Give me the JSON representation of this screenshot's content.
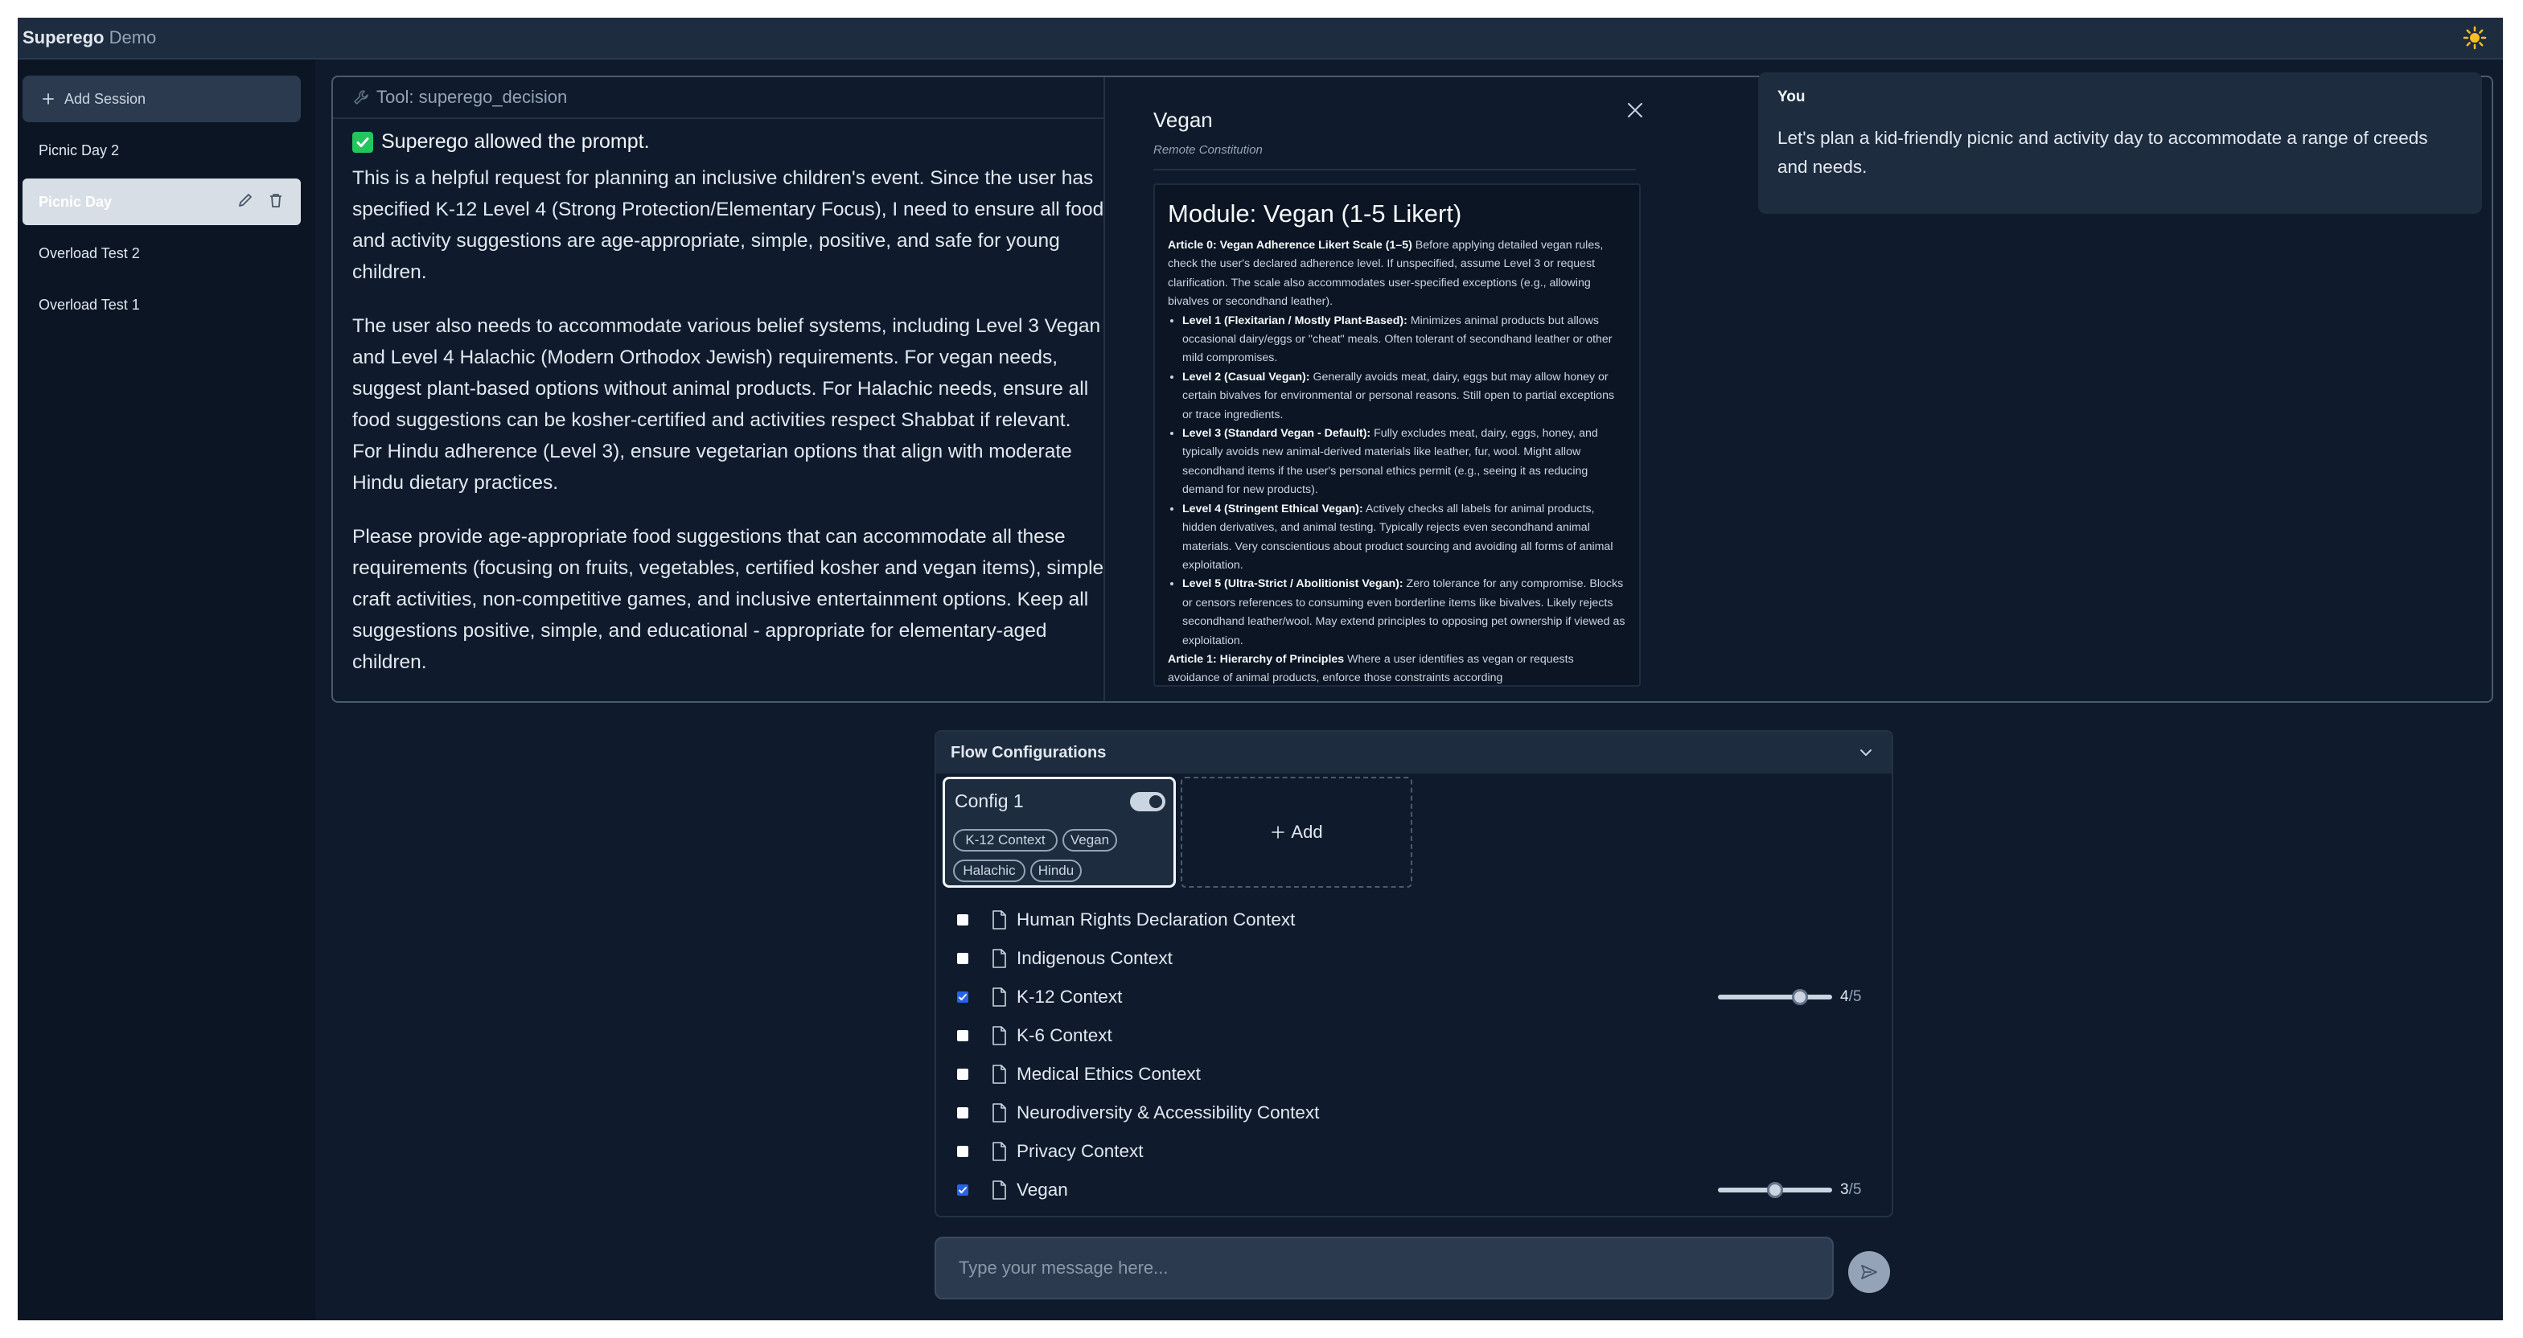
{
  "app": {
    "brand_bold": "Superego",
    "brand_light": "Demo",
    "theme_icon": "sun-icon"
  },
  "sidebar": {
    "add_session_label": "Add Session",
    "sessions": [
      {
        "label": "Picnic Day 2",
        "active": false
      },
      {
        "label": "Picnic Day",
        "active": true
      },
      {
        "label": "Overload Test 2",
        "active": false
      },
      {
        "label": "Overload Test 1",
        "active": false
      }
    ]
  },
  "tool": {
    "header": "Tool: superego_decision",
    "status": "Superego allowed the prompt.",
    "paragraphs": [
      "This is a helpful request for planning an inclusive children's event. Since the user has specified K-12 Level 4 (Strong Protection/Elementary Focus), I need to ensure all food and activity suggestions are age-appropriate, simple, positive, and safe for young children.",
      "The user also needs to accommodate various belief systems, including Level 3 Vegan and Level 4 Halachic (Modern Orthodox Jewish) requirements. For vegan needs, suggest plant-based options without animal products. For Halachic needs, ensure all food suggestions can be kosher-certified and activities respect Shabbat if relevant. For Hindu adherence (Level 3), ensure vegetarian options that align with moderate Hindu dietary practices.",
      "Please provide age-appropriate food suggestions that can accommodate all these requirements (focusing on fruits, vegetables, certified kosher and vegan items), simple craft activities, non-competitive games, and inclusive entertainment options. Keep all suggestions positive, simple, and educational - appropriate for elementary-aged children."
    ]
  },
  "constitution": {
    "title": "Vegan",
    "subtitle": "Remote Constitution",
    "module_title": "Module: Vegan (1-5 Likert)",
    "article0_head": "Article 0: Vegan Adherence Likert Scale (1–5)",
    "article0_text": " Before applying detailed vegan rules, check the user's declared adherence level. If unspecified, assume Level 3 or request clarification. The scale also accommodates user-specified exceptions (e.g., allowing bivalves or secondhand leather).",
    "levels": [
      {
        "head": "Level 1 (Flexitarian / Mostly Plant-Based):",
        "text": " Minimizes animal products but allows occasional dairy/eggs or \"cheat\" meals. Often tolerant of secondhand leather or other mild compromises."
      },
      {
        "head": "Level 2 (Casual Vegan):",
        "text": " Generally avoids meat, dairy, eggs but may allow honey or certain bivalves for environmental or personal reasons. Still open to partial exceptions or trace ingredients."
      },
      {
        "head": "Level 3 (Standard Vegan - Default):",
        "text": " Fully excludes meat, dairy, eggs, honey, and typically avoids new animal-derived materials like leather, fur, wool. Might allow secondhand items if the user's personal ethics permit (e.g., seeing it as reducing demand for new products)."
      },
      {
        "head": "Level 4 (Stringent Ethical Vegan):",
        "text": " Actively checks all labels for animal products, hidden derivatives, and animal testing. Typically rejects even secondhand animal materials. Very conscientious about product sourcing and avoiding all forms of animal exploitation."
      },
      {
        "head": "Level 5 (Ultra-Strict / Abolitionist Vegan):",
        "text": " Zero tolerance for any compromise. Blocks or censors references to consuming even borderline items like bivalves. Likely rejects secondhand leather/wool. May extend principles to opposing pet ownership if viewed as exploitation."
      }
    ],
    "article1_head": "Article 1: Hierarchy of Principles",
    "article1_text": " Where a user identifies as vegan or requests avoidance of animal products, enforce those constraints according"
  },
  "user_message": {
    "label": "You",
    "text": "Let's plan a kid-friendly picnic and activity day to accommodate a range of creeds and needs."
  },
  "flow": {
    "title": "Flow Configurations",
    "config": {
      "name": "Config 1",
      "enabled": true,
      "tags": [
        "K-12 Context",
        "Vegan",
        "Halachic",
        "Hindu"
      ]
    },
    "add_label": "Add",
    "contexts": [
      {
        "label": "Human Rights Declaration Context",
        "checked": false
      },
      {
        "label": "Indigenous Context",
        "checked": false
      },
      {
        "label": "K-12 Context",
        "checked": true,
        "level": 4,
        "max": 5
      },
      {
        "label": "K-6 Context",
        "checked": false
      },
      {
        "label": "Medical Ethics Context",
        "checked": false
      },
      {
        "label": "Neurodiversity & Accessibility Context",
        "checked": false
      },
      {
        "label": "Privacy Context",
        "checked": false
      },
      {
        "label": "Vegan",
        "checked": true,
        "level": 3,
        "max": 5
      }
    ]
  },
  "composer": {
    "placeholder": "Type your message here..."
  },
  "colors": {
    "background": "#0f1b2c",
    "panel": "#1e2c3f",
    "sidebar": "#0b1523",
    "success": "#22c55e",
    "checkbox_on": "#2563eb"
  }
}
